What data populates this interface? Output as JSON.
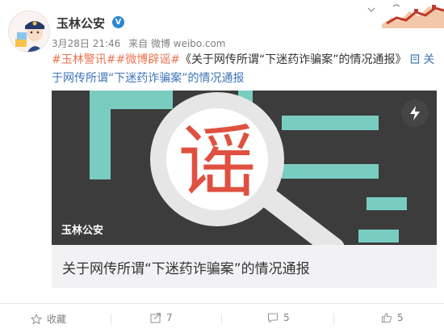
{
  "post": {
    "username": "玉林公安",
    "verified_mark": "V",
    "date": "3月28日 21:46",
    "source": "来自 微博 weibo.com",
    "text": {
      "topic1": "#玉林警讯#",
      "topic2": "#微博辟谣#",
      "title_text": "《关于网传所谓“下迷药诈骗案”的情况通报》",
      "ref_icon": "document-icon",
      "ref_text": "关于网传所谓“下迷药诈骗案”的情况通报"
    }
  },
  "card": {
    "image_char": "谣",
    "source_label": "玉林公安",
    "title": "关于网传所谓“下迷药诈骗案”的情况通报"
  },
  "actions": {
    "favorite_label": "收藏",
    "forward_count": "7",
    "comment_count": "5",
    "like_count": "5"
  },
  "colors": {
    "link": "#eb7350",
    "topic": "#3e74b7",
    "verified": "#2a87d4",
    "card_bg": "#f2f2f5"
  }
}
